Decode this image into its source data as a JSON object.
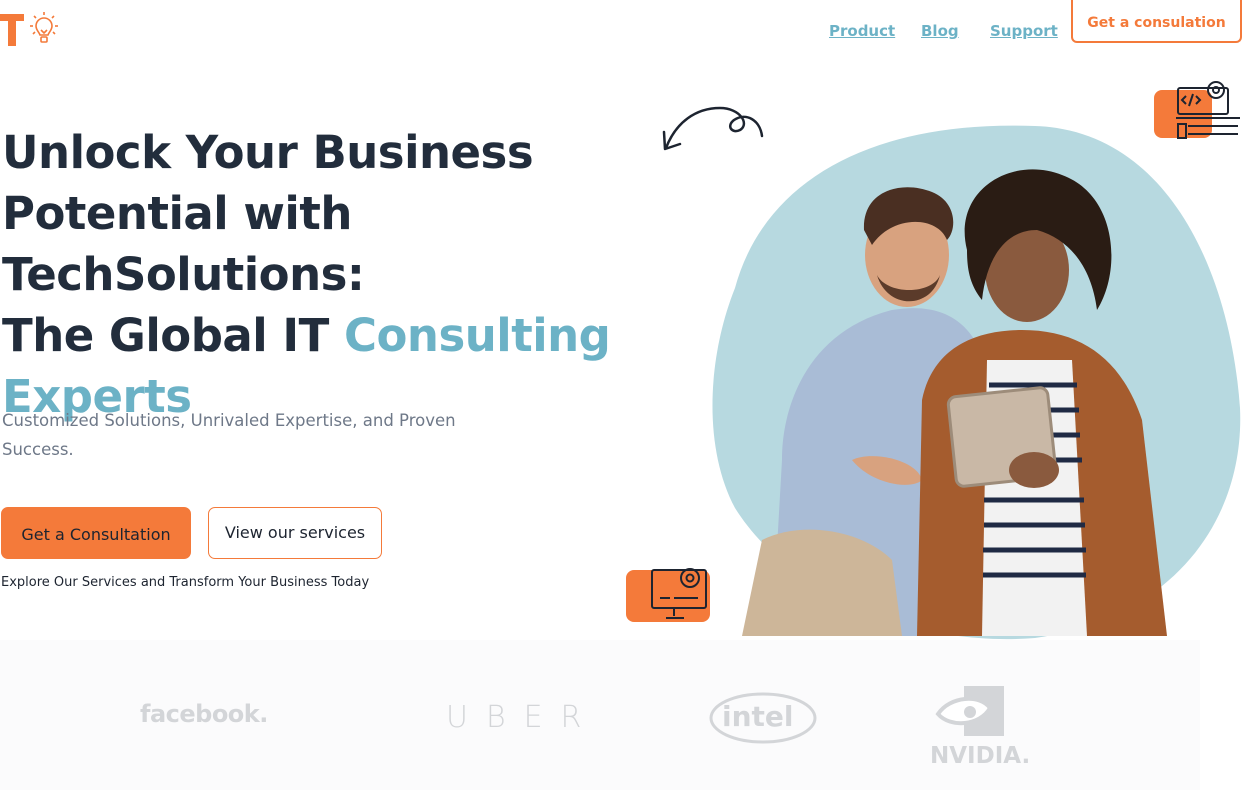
{
  "header": {
    "nav": [
      {
        "label": "Product"
      },
      {
        "label": "Blog"
      },
      {
        "label": "Support"
      }
    ],
    "cta_label": "Get a consulation"
  },
  "hero": {
    "title_line1": "Unlock Your Business",
    "title_line2": "Potential with TechSolutions:",
    "title_line3_dark": "The Global IT ",
    "title_line3_accent": "Consulting",
    "title_line4_accent": "Experts",
    "subtitle": "Customized Solutions, Unrivaled Expertise, and Proven Success.",
    "primary_button": "Get a Consultation",
    "secondary_button": "View our services",
    "tagline": "Explore Our Services and Transform Your Business Today"
  },
  "brands": {
    "facebook": "facebook.",
    "uber": "UBER",
    "intel": "intel",
    "nvidia": "NVIDIA."
  },
  "colors": {
    "accent_orange": "#f47a3a",
    "accent_blue": "#6cb2c6",
    "heading": "#222d3c",
    "body_text": "#6e7888",
    "blob": "#b7d9e0"
  },
  "icons": [
    "lightbulb-icon",
    "curved-arrow-icon",
    "code-gear-icon",
    "monitor-gear-icon"
  ]
}
